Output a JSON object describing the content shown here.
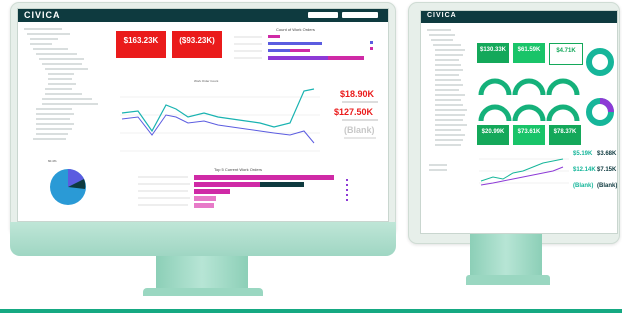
{
  "monitor1": {
    "brand": "CIVICA",
    "kpis": [
      {
        "value": "$163.23K",
        "color": "#ea1b1b"
      },
      {
        "value": "($93.23K)",
        "color": "#ea1b1b"
      }
    ],
    "bar_chart_title": "Count of Work Orders",
    "line_legend": "Work Order Count",
    "side_values": [
      "$18.90K",
      "$127.50K",
      "(Blank)"
    ],
    "bottom_chart_title": "Top 5 Current Work Orders",
    "pie_value": "60.4%",
    "colors": {
      "header": "#0e3a3f",
      "kpi": "#ea1b1b",
      "line": "#19b3b1",
      "line2": "#5b5ce0",
      "bar": "#cf2aa6",
      "pie": "#2a9ad6",
      "pie2": "#5b5ce0"
    }
  },
  "monitor2": {
    "brand": "CIVICA",
    "tiles": [
      {
        "value": "$130.33K",
        "color": "#14a85a"
      },
      {
        "value": "$61.59K",
        "color": "#14a85a"
      },
      {
        "value": "$4.71K",
        "color": "#14a85a"
      },
      {
        "value": "$20.99K",
        "color": "#14a85a"
      },
      {
        "value": "$73.61K",
        "color": "#14a85a"
      },
      {
        "value": "$78.37K",
        "color": "#14a85a"
      }
    ],
    "right_values": [
      "$5.19K",
      "$3.68K",
      "$12.14K",
      "$7.15K",
      "(Blank)",
      "(Blank)"
    ],
    "colors": {
      "header": "#0e3a3f",
      "tile": "#14a85a",
      "gauge": "#15b17a",
      "donut": "#16b69a",
      "donut2": "#8d3ad6"
    }
  }
}
